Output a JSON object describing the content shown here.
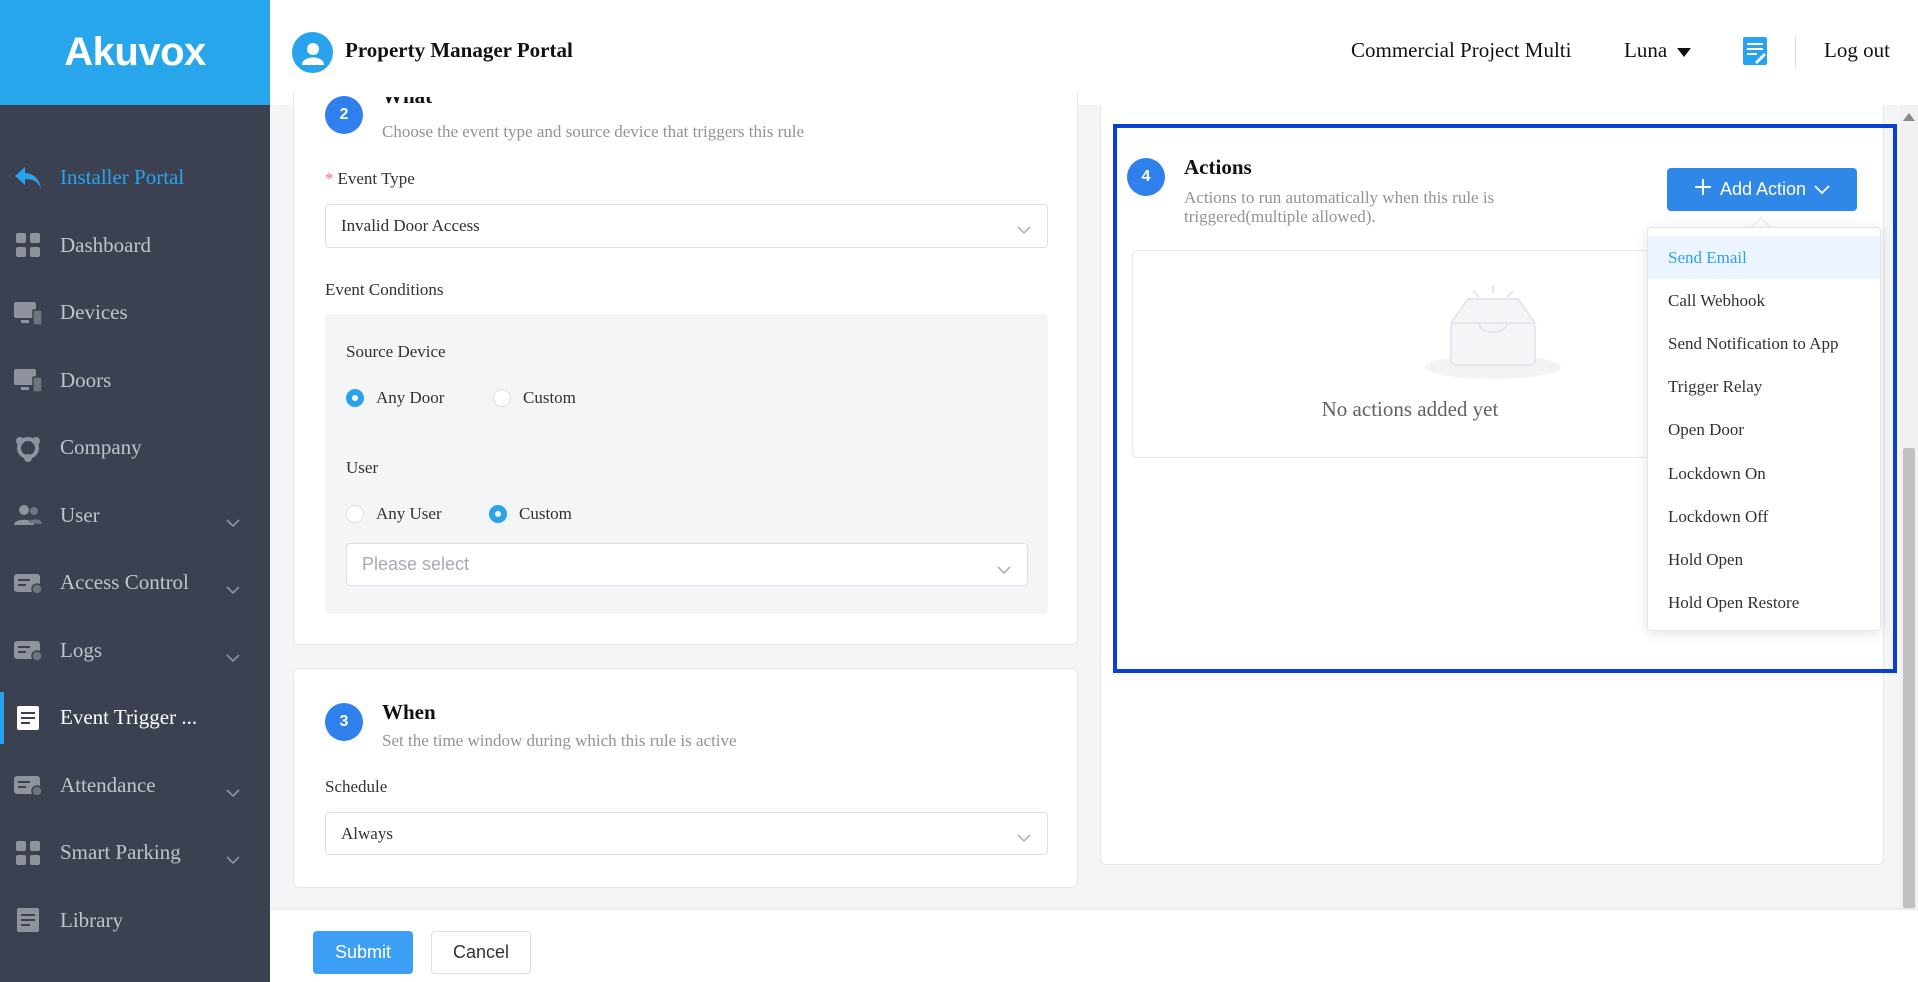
{
  "brand": {
    "logo": "Akuvox"
  },
  "header": {
    "portal_title": "Property Manager Portal",
    "project": "Commercial Project Multi",
    "user": "Luna",
    "logout": "Log out",
    "icons": {
      "avatar": "user-avatar-icon",
      "doc": "document-icon",
      "caret": "caret-down-icon"
    }
  },
  "sidebar": {
    "items": [
      {
        "label": "Installer Portal",
        "icon": "back-arrow-icon",
        "expandable": false
      },
      {
        "label": "Dashboard",
        "icon": "dashboard-icon",
        "expandable": false
      },
      {
        "label": "Devices",
        "icon": "devices-icon",
        "expandable": false
      },
      {
        "label": "Doors",
        "icon": "doors-icon",
        "expandable": false
      },
      {
        "label": "Company",
        "icon": "company-icon",
        "expandable": false
      },
      {
        "label": "User",
        "icon": "user-group-icon",
        "expandable": true
      },
      {
        "label": "Access Control",
        "icon": "access-control-icon",
        "expandable": true
      },
      {
        "label": "Logs",
        "icon": "logs-icon",
        "expandable": true
      },
      {
        "label": "Event Trigger ...",
        "icon": "event-trigger-icon",
        "expandable": false,
        "active": true
      },
      {
        "label": "Attendance",
        "icon": "attendance-icon",
        "expandable": true
      },
      {
        "label": "Smart Parking",
        "icon": "smart-parking-icon",
        "expandable": true
      },
      {
        "label": "Library",
        "icon": "library-icon",
        "expandable": false
      }
    ]
  },
  "what": {
    "step": "2",
    "title": "What",
    "subtitle": "Choose the event type and source device that triggers this rule",
    "event_type_label": "Event Type",
    "event_type_value": "Invalid Door Access",
    "conditions_label": "Event Conditions",
    "source_device_label": "Source Device",
    "source_any": "Any Door",
    "source_custom": "Custom",
    "user_label": "User",
    "user_any": "Any User",
    "user_custom": "Custom",
    "user_select_placeholder": "Please select"
  },
  "when": {
    "step": "3",
    "title": "When",
    "subtitle": "Set the time window during which this rule is active",
    "schedule_label": "Schedule",
    "schedule_value": "Always"
  },
  "actions": {
    "step": "4",
    "title": "Actions",
    "subtitle_line1": "Actions to run automatically when this rule is",
    "subtitle_line2": "triggered(multiple allowed).",
    "add_button": "Add Action",
    "empty_text": "No actions added yet",
    "dropdown": [
      "Send Email",
      "Call Webhook",
      "Send Notification to App",
      "Trigger Relay",
      "Open Door",
      "Lockdown On",
      "Lockdown Off",
      "Hold Open",
      "Hold Open Restore"
    ]
  },
  "footer": {
    "submit": "Submit",
    "cancel": "Cancel"
  },
  "colors": {
    "brand": "#28a6ec",
    "sidebar": "#3b4150",
    "primary": "#2f87e8",
    "highlight": "#0a3fd4"
  }
}
